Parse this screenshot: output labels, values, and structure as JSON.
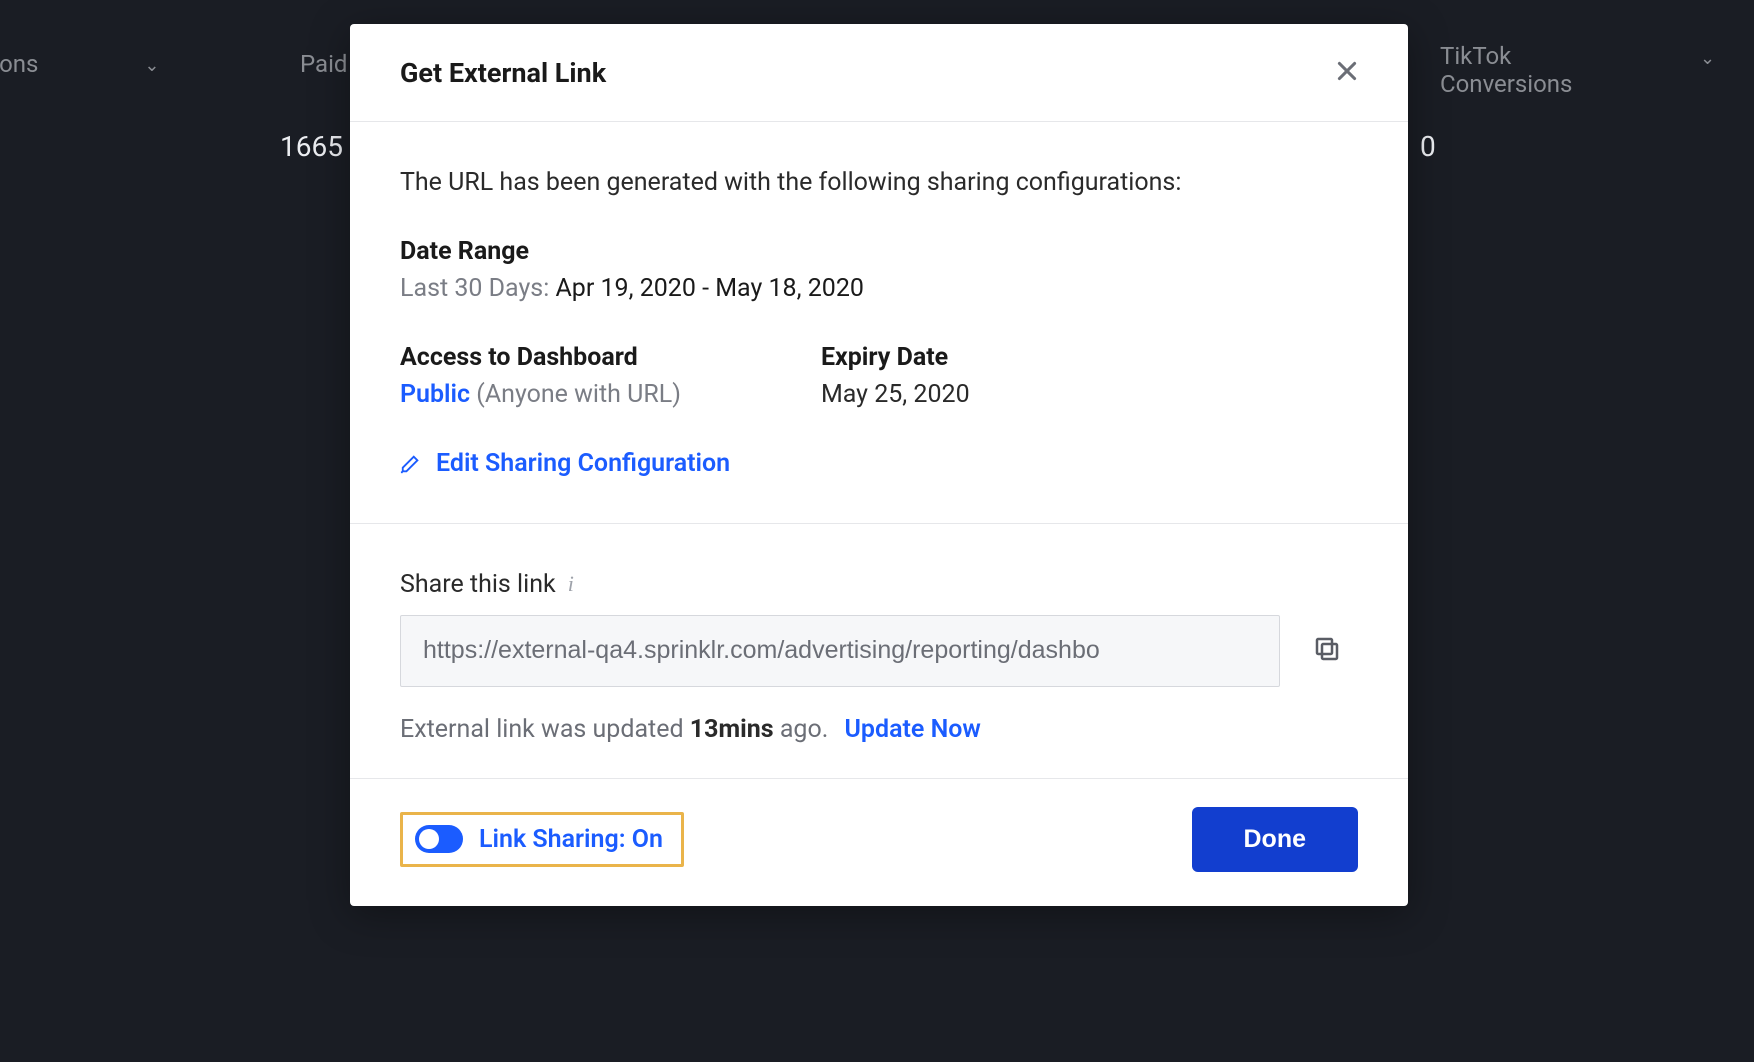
{
  "background": {
    "col1_header": "ersions",
    "col2_header": "Paid",
    "col3_header": "TikTok\nConversions",
    "val1": "1665",
    "val2": "0"
  },
  "modal": {
    "title": "Get External Link",
    "intro": "The URL has been generated with the following sharing configurations:",
    "date_range_label": "Date Range",
    "date_range_prefix": "Last 30 Days: ",
    "date_range_value": "Apr 19, 2020 - May 18, 2020",
    "access_label": "Access to Dashboard",
    "access_value": "Public",
    "access_note": " (Anyone with URL)",
    "expiry_label": "Expiry Date",
    "expiry_value": "May 25, 2020",
    "edit_link": "Edit Sharing Configuration",
    "share_label": "Share this link",
    "url_value": "https://external-qa4.sprinklr.com/advertising/reporting/dashbo",
    "updated_prefix": "External link was updated ",
    "updated_time": "13mins",
    "updated_suffix": " ago.",
    "update_now": "Update Now",
    "link_sharing_label": "Link Sharing: On",
    "done": "Done"
  }
}
